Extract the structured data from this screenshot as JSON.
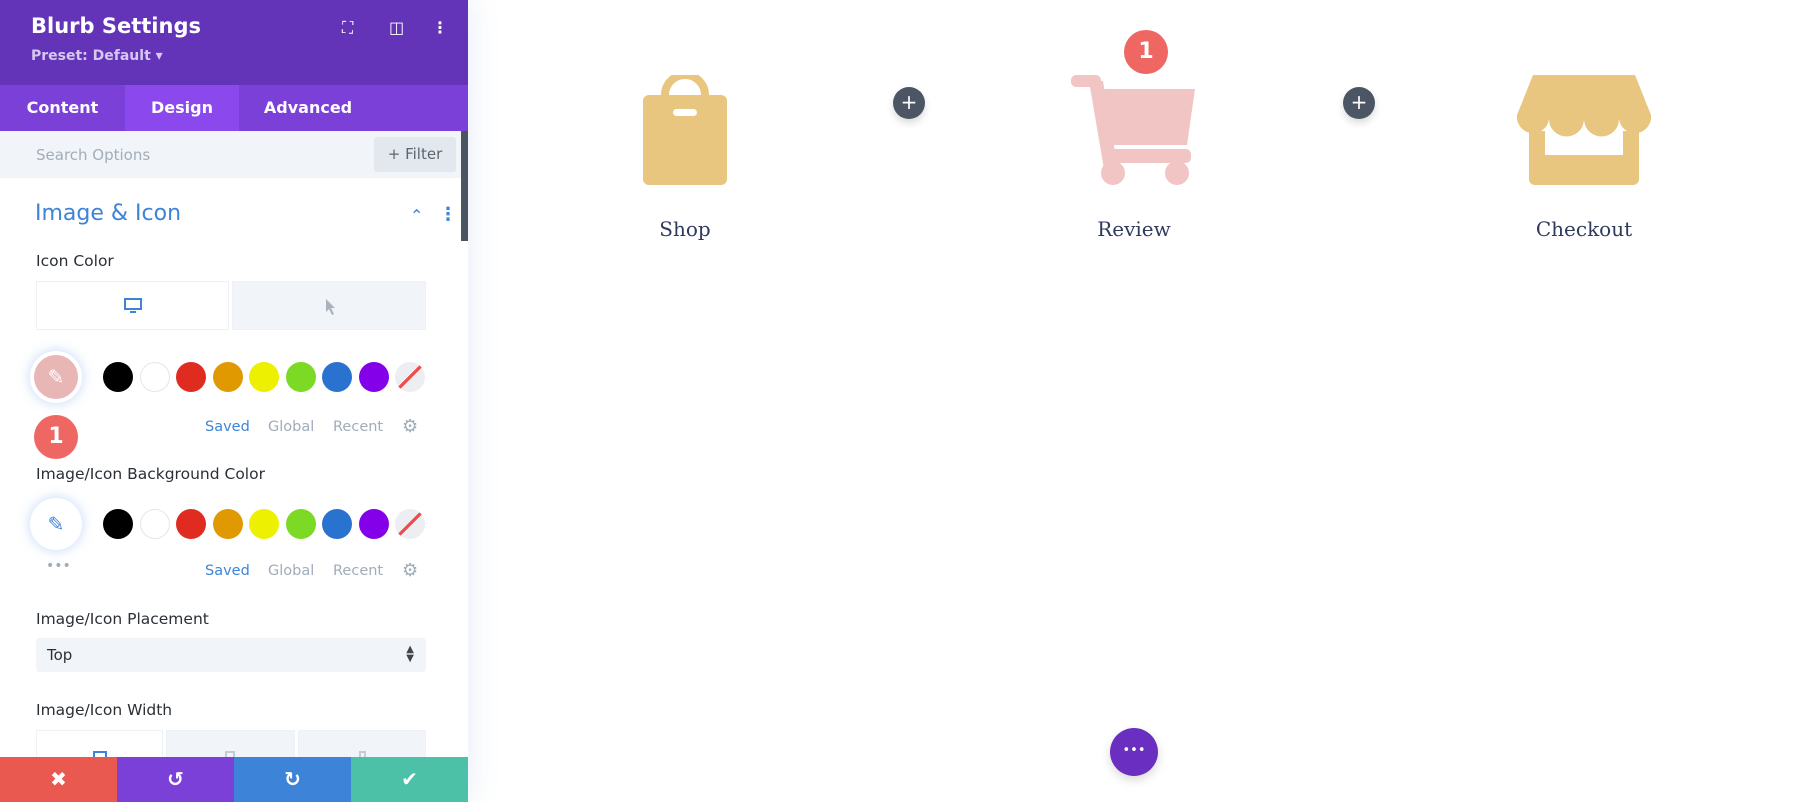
{
  "panel": {
    "title": "Blurb Settings",
    "preset": "Preset: Default ▾",
    "tabs": [
      {
        "label": "Content"
      },
      {
        "label": "Design",
        "active": true
      },
      {
        "label": "Advanced"
      }
    ],
    "search_placeholder": "Search Options",
    "filter_label": "+ Filter",
    "section_title": "Image & Icon",
    "icon_color": {
      "label": "Icon Color",
      "value": "#e8b7b5",
      "links": [
        "Saved",
        "Global",
        "Recent"
      ]
    },
    "bg_color": {
      "label": "Image/Icon Background Color",
      "links": [
        "Saved",
        "Global",
        "Recent"
      ]
    },
    "swatches": [
      "#000000",
      "#ffffff",
      "#e02b20",
      "#e09900",
      "#edf000",
      "#7cda24",
      "#2a72d0",
      "#8300e9",
      "transparent"
    ],
    "placement": {
      "label": "Image/Icon Placement",
      "value": "Top"
    },
    "width_label": "Image/Icon Width",
    "badge": "1",
    "footer": {
      "colors": [
        "#e9594f",
        "#7b40d8",
        "#3d84d8",
        "#4cc1a8"
      ]
    }
  },
  "canvas": {
    "badge": "1",
    "items": [
      {
        "label": "Shop",
        "icon": "shopping-bag-icon",
        "color": "#e8c67f"
      },
      {
        "label": "Review",
        "icon": "shopping-cart-icon",
        "color": "#f2c5c5"
      },
      {
        "label": "Checkout",
        "icon": "store-icon",
        "color": "#e8c67f"
      }
    ],
    "add_label": "+",
    "more_label": "•••"
  },
  "colors": {
    "accent": "#7b40d8",
    "header": "#6434b8",
    "link": "#3d84d8",
    "badge": "#ef6762"
  }
}
